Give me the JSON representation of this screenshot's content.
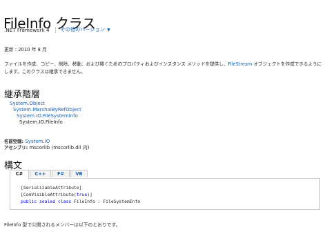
{
  "title": "FileInfo クラス",
  "version_bar": {
    "framework": ".NET Framework 4",
    "other_versions": "その他のバージョン"
  },
  "updated": "更新 : 2010 年 8 月",
  "description": {
    "before_link": "ファイルを作成、コピー、削除、移動、および開くためのプロパティおよびインスタンス メソッドを提供し、",
    "link": "FileStream",
    "after_link": " オブジェクトを作成できるようにします。このクラスは継承できません。"
  },
  "inheritance": {
    "heading": "継承階層",
    "items": [
      "System.Object",
      "System.MarshalByRefObject",
      "System.IO.FileSystemInfo",
      "System.IO.FileInfo"
    ]
  },
  "namespace": {
    "label": "名前空間:",
    "value": "System.IO"
  },
  "assembly": {
    "label": "アセンブリ:",
    "value": "mscorlib (mscorlib.dll 内)"
  },
  "syntax": {
    "heading": "構文",
    "tabs": [
      "C#",
      "C++",
      "F#",
      "VB"
    ],
    "active_tab": "C#",
    "code": {
      "line1": "[SerializableAttribute]",
      "line2_prefix": "[ComVisibleAttribute(",
      "line2_kw": "true",
      "line2_suffix": ")]",
      "kw_public": "public",
      "kw_sealed": "sealed",
      "kw_class": "class",
      "decl": "FileInfo : FileSystemInfo"
    }
  },
  "footer": "FileInfo 型で公開されるメンバーは以下のとおりです。",
  "colors": {
    "link": "#1a62b5",
    "keyword": "#0000ee",
    "border": "#c7c7c7"
  }
}
